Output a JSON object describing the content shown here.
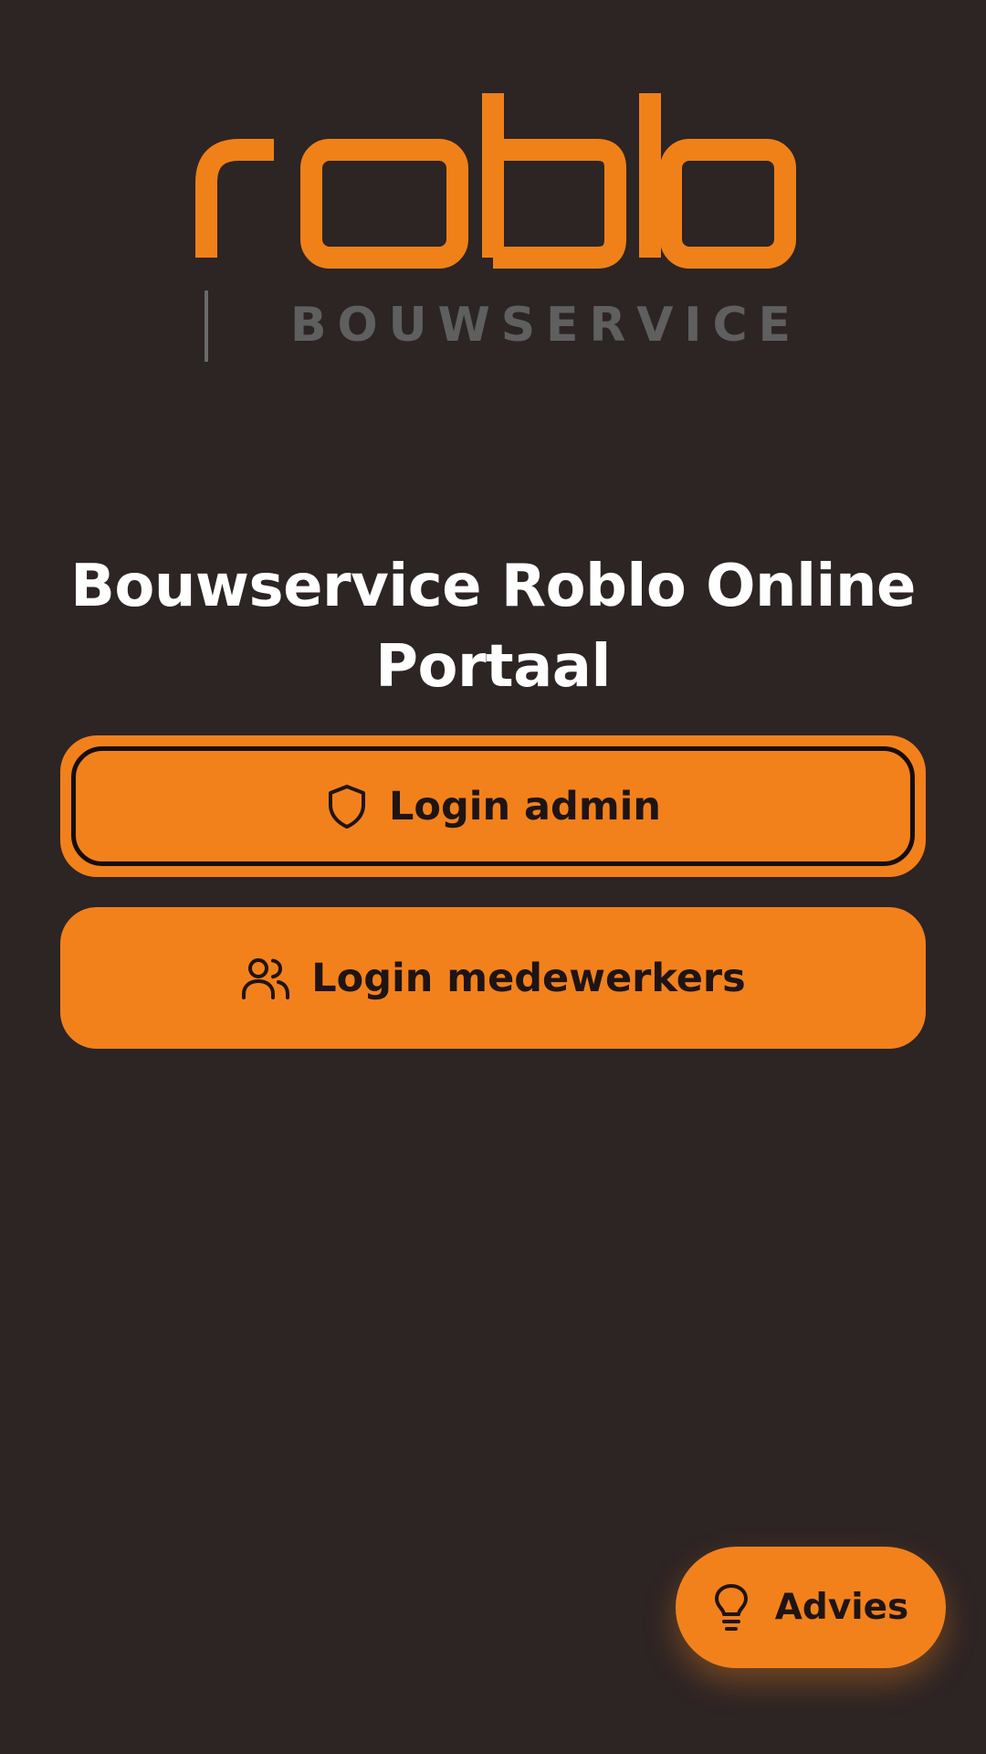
{
  "logo": {
    "wordmark": "roblo",
    "tagline": "BOUWSERVICE"
  },
  "page": {
    "title": "Bouwservice Roblo Online Portaal"
  },
  "buttons": {
    "admin": {
      "label": "Login admin",
      "icon": "shield-icon"
    },
    "staff": {
      "label": "Login medewerkers",
      "icon": "users-icon"
    }
  },
  "fab": {
    "label": "Advies",
    "icon": "lightbulb-icon"
  },
  "colors": {
    "background": "#2d2424",
    "accent": "#f2811c",
    "button_text": "#1f1414",
    "title_text": "#ffffff",
    "logo_tagline": "#5f5f5f"
  }
}
